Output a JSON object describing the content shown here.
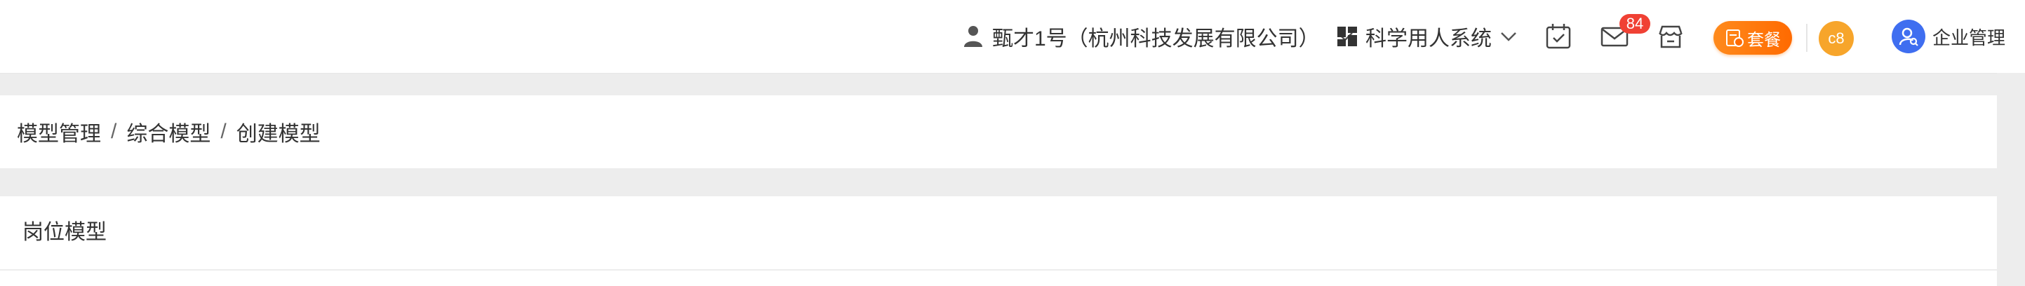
{
  "header": {
    "user_label": "甄才1号（杭州科技发展有限公司）",
    "system_label": "科学用人系统",
    "mail_badge": "84",
    "package_label": "套餐",
    "avatar_text": "c8",
    "admin_label": "企业管理"
  },
  "breadcrumb": {
    "items": [
      "模型管理",
      "综合模型",
      "创建模型"
    ],
    "separator": "/"
  },
  "section": {
    "title": "岗位模型"
  },
  "colors": {
    "badge": "#f04134",
    "package": "#ff7a0e",
    "avatar": "#f7a52b",
    "admin_avatar": "#3f6ef0"
  },
  "icons": [
    "user-icon",
    "chevron-down-icon",
    "grid-icon",
    "calendar-check-icon",
    "mail-icon",
    "store-icon",
    "package-icon",
    "admin-avatar-icon"
  ]
}
